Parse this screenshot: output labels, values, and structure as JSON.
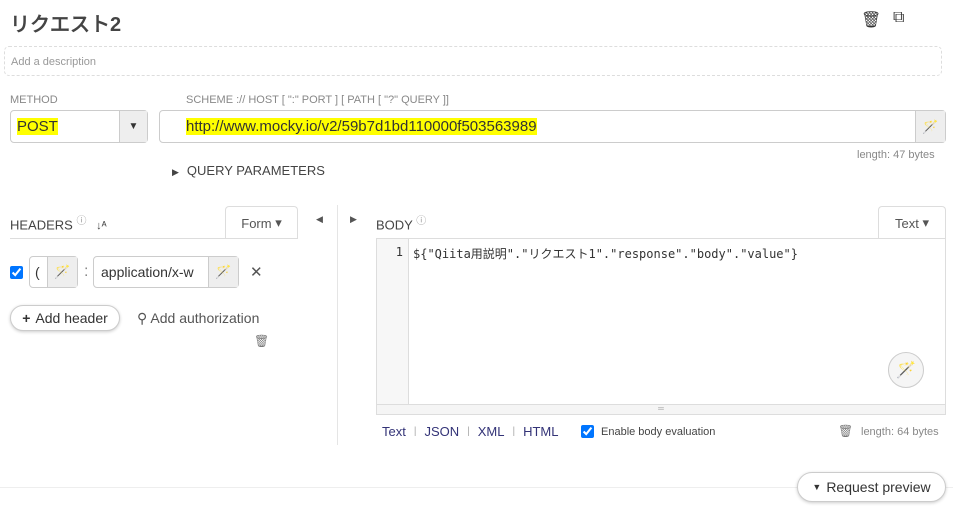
{
  "title": "リクエスト2",
  "description_placeholder": "Add a description",
  "method": {
    "label": "METHOD",
    "value": "POST"
  },
  "url": {
    "label": "SCHEME :// HOST [ \":\" PORT ] [ PATH [ \"?\" QUERY ]]",
    "value": "http://www.mocky.io/v2/59b7d1bd110000f503563989",
    "length": "length: 47 bytes"
  },
  "query_params": "QUERY PARAMETERS",
  "headers": {
    "label": "HEADERS",
    "mode": "Form",
    "rows": [
      {
        "name": "(",
        "value": "application/x-w"
      }
    ],
    "add_header": "Add header",
    "add_auth": "Add authorization"
  },
  "body": {
    "label": "BODY",
    "mode": "Text",
    "line_no": "1",
    "content": "${\"Qiita用説明\".\"リクエスト1\".\"response\".\"body\".\"value\"}",
    "formats": [
      "Text",
      "JSON",
      "XML",
      "HTML"
    ],
    "enable_eval": "Enable body evaluation",
    "length": "length: 64 bytes"
  },
  "request_preview": "Request preview",
  "colors": {
    "highlight": "#ffff00"
  }
}
